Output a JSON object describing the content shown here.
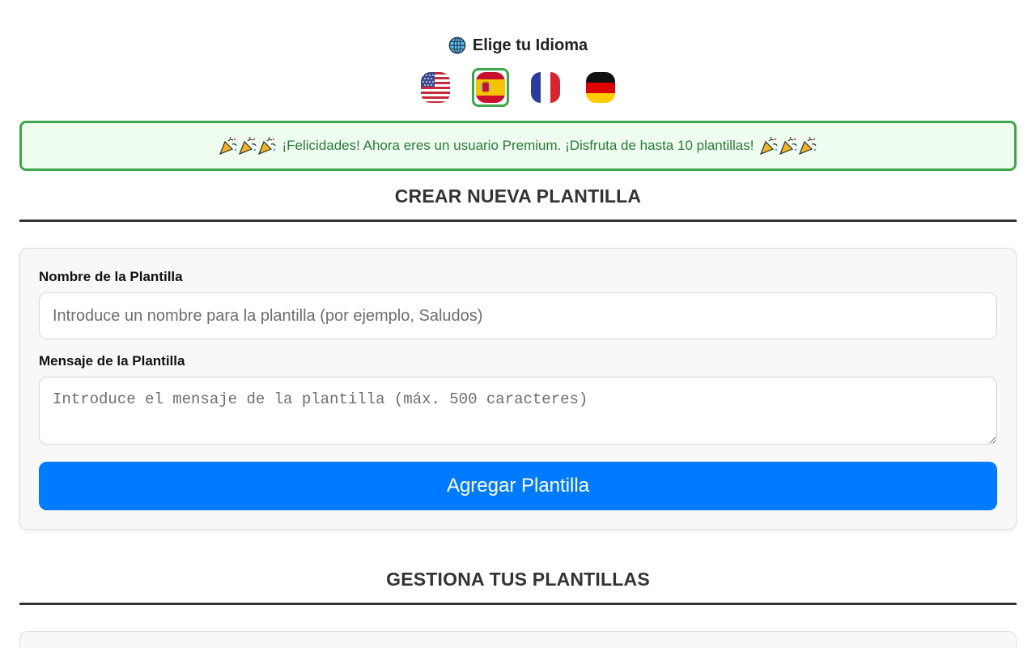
{
  "language": {
    "title": "Elige tu Idioma",
    "globe_icon": "globe-icon",
    "flags": [
      {
        "code": "en-US",
        "icon": "us-flag-icon",
        "selected": false
      },
      {
        "code": "es",
        "icon": "spain-flag-icon",
        "selected": true
      },
      {
        "code": "fr",
        "icon": "france-flag-icon",
        "selected": false
      },
      {
        "code": "de",
        "icon": "germany-flag-icon",
        "selected": false
      }
    ],
    "selected_border_color": "#3fa64b"
  },
  "banner": {
    "text": "¡Felicidades! Ahora eres un usuario Premium. ¡Disfruta de hasta 10 plantillas!",
    "icon": "party-popper-icon",
    "border_color": "#3fa64b",
    "background": "#eefdf0",
    "text_color": "#2c7a38"
  },
  "create": {
    "title": "CREAR NUEVA PLANTILLA",
    "name_label": "Nombre de la Plantilla",
    "name_value": "",
    "name_placeholder": "Introduce un nombre para la plantilla (por ejemplo, Saludos)",
    "message_label": "Mensaje de la Plantilla",
    "message_value": "",
    "message_placeholder": "Introduce el mensaje de la plantilla (máx. 500 caracteres)",
    "add_button_label": "Agregar Plantilla",
    "button_color": "#007bff"
  },
  "manage": {
    "title": "GESTIONA TUS PLANTILLAS"
  }
}
